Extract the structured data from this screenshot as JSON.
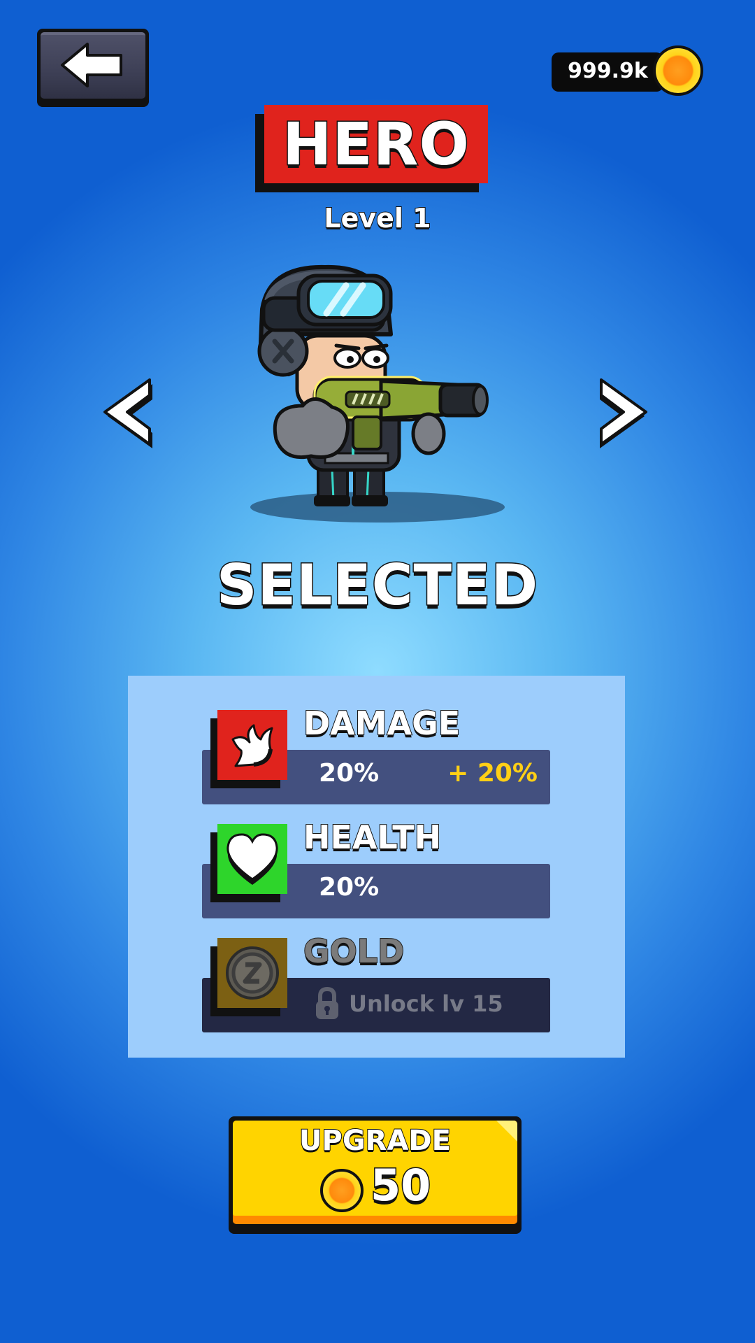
{
  "header": {
    "back_icon": "arrow-left-icon",
    "currency_amount": "999.9k",
    "currency_icon": "gold-coin-icon"
  },
  "title": "HERO",
  "level": "Level 1",
  "carousel": {
    "prev_icon": "chevron-left-icon",
    "next_icon": "chevron-right-icon",
    "status": "SELECTED"
  },
  "stats": [
    {
      "label": "DAMAGE",
      "value": "20%",
      "bonus": "+ 20%",
      "icon": "claw-icon",
      "color": "#e0231d"
    },
    {
      "label": "HEALTH",
      "value": "20%",
      "icon": "heart-icon",
      "color": "#2ed52b"
    },
    {
      "label": "GOLD",
      "locked_text": "Unlock lv 15",
      "icon": "gold-coin-icon",
      "lock_icon": "lock-icon",
      "color": "#7c6013"
    }
  ],
  "upgrade": {
    "label": "UPGRADE",
    "cost": "50",
    "cost_icon": "gold-coin-icon",
    "color": "#ffd400"
  },
  "colors": {
    "background_center": "#8fdcff",
    "background_edge": "#0f5fd1",
    "panel": "#9dcdfc",
    "stat_bar": "#43507f",
    "bonus": "#ffcf16"
  }
}
